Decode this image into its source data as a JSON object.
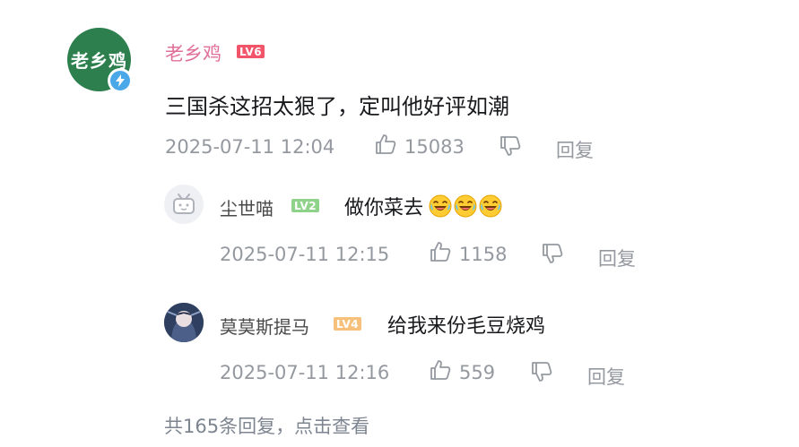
{
  "main_comment": {
    "avatar_text": "老乡鸡",
    "username": "老乡鸡",
    "level": "LV6",
    "text": "三国杀这招太狠了，定叫他好评如潮",
    "timestamp": "2025-07-11 12:04",
    "likes": "15083",
    "reply_label": "回复"
  },
  "replies": [
    {
      "username": "尘世喵",
      "level": "LV2",
      "text": "做你菜去",
      "emoji_count": 3,
      "timestamp": "2025-07-11 12:15",
      "likes": "1158",
      "reply_label": "回复"
    },
    {
      "username": "莫莫斯提马",
      "level": "LV4",
      "text": "给我来份毛豆烧鸡",
      "timestamp": "2025-07-11 12:16",
      "likes": "559",
      "reply_label": "回复"
    }
  ],
  "more_replies": "共165条回复，点击查看",
  "colors": {
    "username_main": "#e0709a",
    "lv6": "#f2556a",
    "lv2": "#8fd38a",
    "lv4": "#f7c07b",
    "meta": "#9499a0",
    "avatar_main_bg": "#2d7f4e"
  },
  "icons": [
    "thumbs-up-icon",
    "thumbs-down-icon",
    "verified-lightning-icon",
    "laughing-crying-emoji"
  ]
}
